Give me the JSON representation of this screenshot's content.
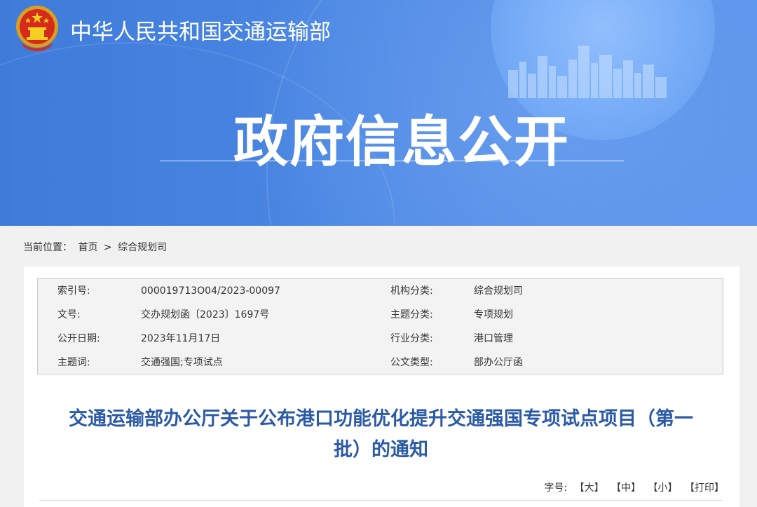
{
  "header": {
    "site_name": "中华人民共和国交通运输部",
    "banner_title": "政府信息公开",
    "emblem_icon": "national-emblem-icon",
    "banner_color": "#4a86e2"
  },
  "breadcrumb": {
    "prefix": "当前位置：",
    "home": "首页",
    "separator": ">",
    "current": "综合规划司"
  },
  "meta": {
    "rows": [
      {
        "label1": "索引号:",
        "value1": "000019713O04/2023-00097",
        "label2": "机构分类:",
        "value2": "综合规划司"
      },
      {
        "label1": "文号:",
        "value1": "交办规划函〔2023〕1697号",
        "label2": "主题分类:",
        "value2": "专项规划"
      },
      {
        "label1": "公开日期:",
        "value1": "2023年11月17日",
        "label2": "行业分类:",
        "value2": "港口管理"
      },
      {
        "label1": "主题词:",
        "value1": "交通强国;专项试点",
        "label2": "公文类型:",
        "value2": "部办公厅函"
      }
    ]
  },
  "document": {
    "title_line1": "交通运输部办公厅关于公布港口功能优化提升交通强国专项试点项目（第一",
    "title_line2": "批）的通知",
    "title_color": "#2b5aa6"
  },
  "font_controls": {
    "label": "字号:",
    "large": "【大】",
    "medium": "【中】",
    "small": "【小】",
    "print": "【打印】"
  }
}
